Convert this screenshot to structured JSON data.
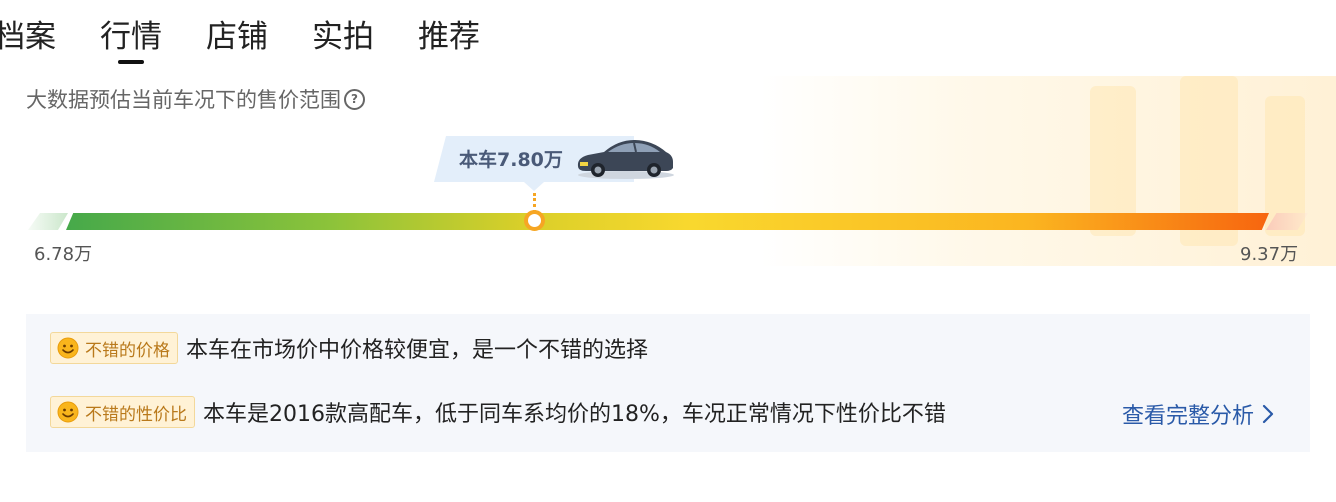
{
  "tabs": [
    {
      "label": "档案",
      "active": false
    },
    {
      "label": "行情",
      "active": true
    },
    {
      "label": "店铺",
      "active": false
    },
    {
      "label": "实拍",
      "active": false
    },
    {
      "label": "推荐",
      "active": false
    }
  ],
  "subtitle": "大数据预估当前车况下的售价范围",
  "help_icon": "question-circle-icon",
  "current_price_label": "本车7.80万",
  "car_icon": "car-icon",
  "price_range": {
    "min_label": "6.78万",
    "max_label": "9.37万",
    "min": 6.78,
    "max": 9.37,
    "current": 7.8
  },
  "summary": {
    "rows": [
      {
        "tag": "不错的价格",
        "icon": "smile-icon",
        "text": "本车在市场价中价格较便宜，是一个不错的选择"
      },
      {
        "tag": "不错的性价比",
        "icon": "smile-icon",
        "text": "本车是2016款高配车，低于同车系均价的18%，车况正常情况下性价比不错"
      }
    ],
    "link_label": "查看完整分析"
  },
  "colors": {
    "bar_start": "#46a94a",
    "bar_mid": "#f9d82e",
    "bar_end": "#f7650f",
    "marker": "#f6a623",
    "tag_bg": "#fff2d6",
    "tag_text": "#b9791b",
    "link": "#2a5aa8",
    "bubble_bg": "#e3eefa"
  }
}
